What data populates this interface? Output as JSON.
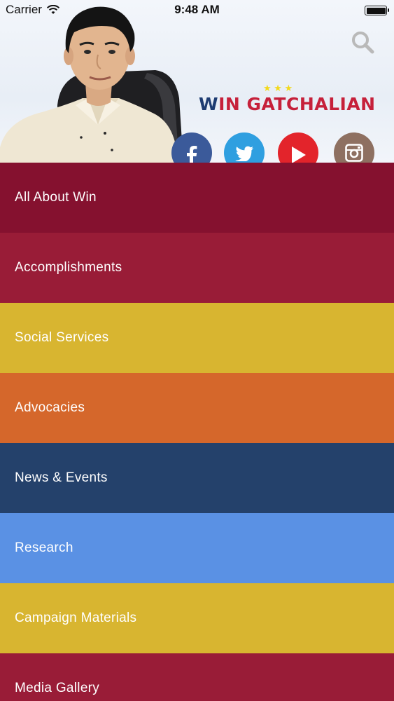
{
  "status_bar": {
    "carrier": "Carrier",
    "time": "9:48 AM"
  },
  "header": {
    "logo_text_w": "W",
    "logo_text_rest": "IN GATCHALIAN",
    "logo_stars": "★ ★ ★",
    "icons": {
      "search": "search-icon",
      "facebook": "facebook-icon",
      "twitter": "twitter-icon",
      "youtube": "youtube-icon",
      "instagram": "instagram-icon"
    }
  },
  "colors": {
    "maroon": "#85112f",
    "crimson": "#991c37",
    "mustard": "#d8b530",
    "orange": "#d5672b",
    "navy": "#24416b",
    "sky": "#5a91e4"
  },
  "menu": {
    "items": [
      {
        "label": "All About Win",
        "color": "#85112f"
      },
      {
        "label": "Accomplishments",
        "color": "#991c37"
      },
      {
        "label": "Social Services",
        "color": "#d8b530"
      },
      {
        "label": "Advocacies",
        "color": "#d5672b"
      },
      {
        "label": "News & Events",
        "color": "#24416b"
      },
      {
        "label": "Research",
        "color": "#5a91e4"
      },
      {
        "label": "Campaign Materials",
        "color": "#d8b530"
      },
      {
        "label": "Media Gallery",
        "color": "#991c37"
      }
    ]
  }
}
